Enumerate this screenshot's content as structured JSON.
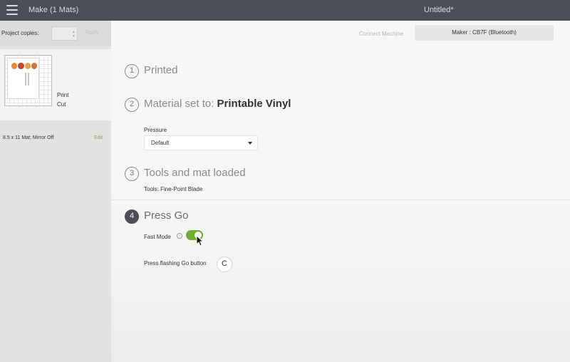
{
  "topbar": {
    "app_title": "Make (1 Mats)",
    "doc_title": "Untitled*",
    "menu_icon": "hamburger-icon"
  },
  "left_panel": {
    "copies_label": "Project copies:",
    "copies_value": "",
    "apply_label": "Apply",
    "mat": {
      "print_label": "Print",
      "cut_label": "Cut",
      "info": "8.5 x 11 Mat; Mirror Off",
      "edit_label": "Edit"
    }
  },
  "header": {
    "connect_label": "Connect Machine",
    "machine_label": "Maker : CB7F (Bluetooth)"
  },
  "steps": {
    "s1": {
      "number": "1",
      "title": "Printed"
    },
    "s2": {
      "number": "2",
      "title_prefix": "Material set to:",
      "title_bold": "Printable Vinyl",
      "pressure_label": "Pressure",
      "pressure_value": "Default"
    },
    "s3": {
      "number": "3",
      "title": "Tools and mat loaded",
      "tools": "Tools: Fine-Point Blade"
    },
    "s4": {
      "number": "4",
      "title": "Press Go",
      "fast_mode_label": "Fast Mode",
      "fast_mode_on": true,
      "press_go_label": "Press flashing Go button",
      "go_icon": "go-icon"
    }
  },
  "colors": {
    "accent_green": "#6fae33",
    "topbar": "#4a4f57"
  }
}
